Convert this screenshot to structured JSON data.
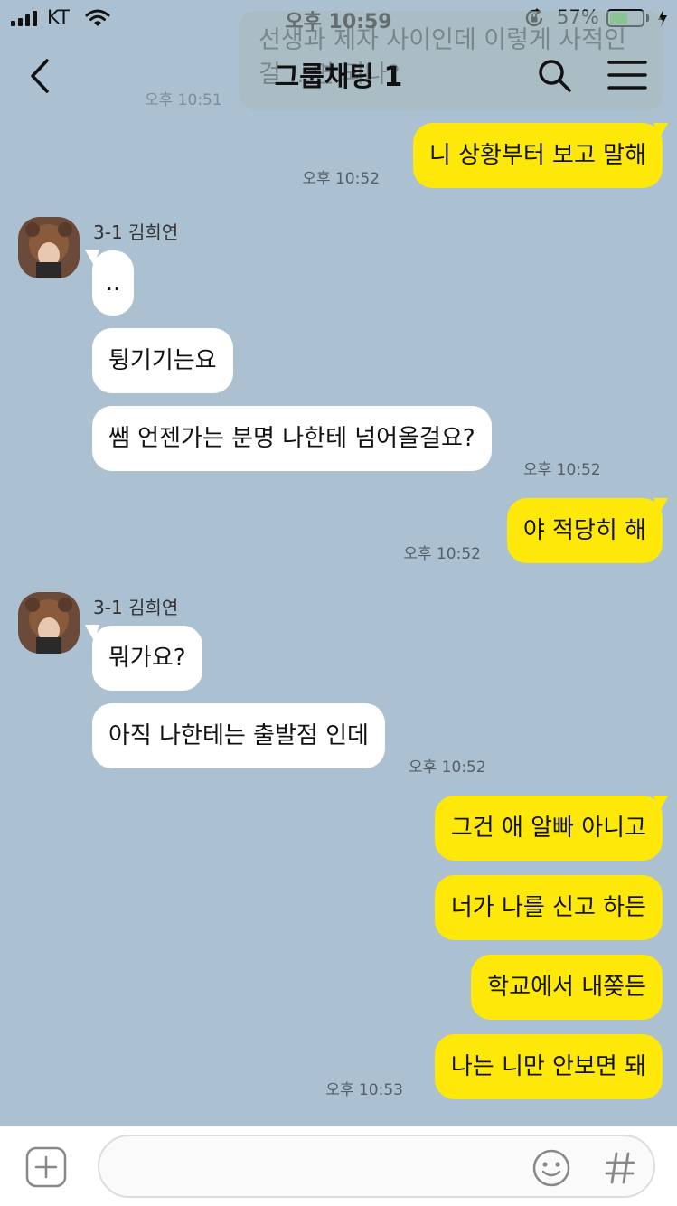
{
  "status_bar": {
    "carrier": "KT",
    "time": "오후 10:59",
    "battery_percent": "57%",
    "battery_level": 0.57
  },
  "header": {
    "title": "그룹채팅 1"
  },
  "banner": {
    "text_line1": "선생과 제자 사이인데 이렇게 사적인",
    "text_line2": "걸 ...면 되나?",
    "time": "오후 10:51"
  },
  "messages": {
    "m1": {
      "text": "니 상황부터 보고 말해",
      "time": "오후 10:52"
    },
    "g1": {
      "sender": "3-1 김희연"
    },
    "m2": {
      "text": ".."
    },
    "m3": {
      "text": "튕기기는요"
    },
    "m4": {
      "text": "쌤 언젠가는 분명 나한테 넘어올걸요?",
      "time": "오후 10:52"
    },
    "m5": {
      "text": "야 적당히 해",
      "time": "오후 10:52"
    },
    "g2": {
      "sender": "3-1 김희연"
    },
    "m6": {
      "text": "뭐가요?"
    },
    "m7": {
      "text": "아직 나한테는 출발점 인데",
      "time": "오후 10:52"
    },
    "m8": {
      "text": "그건 애 알빠 아니고"
    },
    "m9": {
      "text": "너가 나를 신고 하든"
    },
    "m10": {
      "text": "학교에서 내쫒든"
    },
    "m11": {
      "text": "나는 니만 안보면 돼",
      "time": "오후 10:53"
    }
  },
  "colors": {
    "background": "#abc1d1",
    "my_bubble": "#fde80a",
    "other_bubble": "#ffffff"
  }
}
